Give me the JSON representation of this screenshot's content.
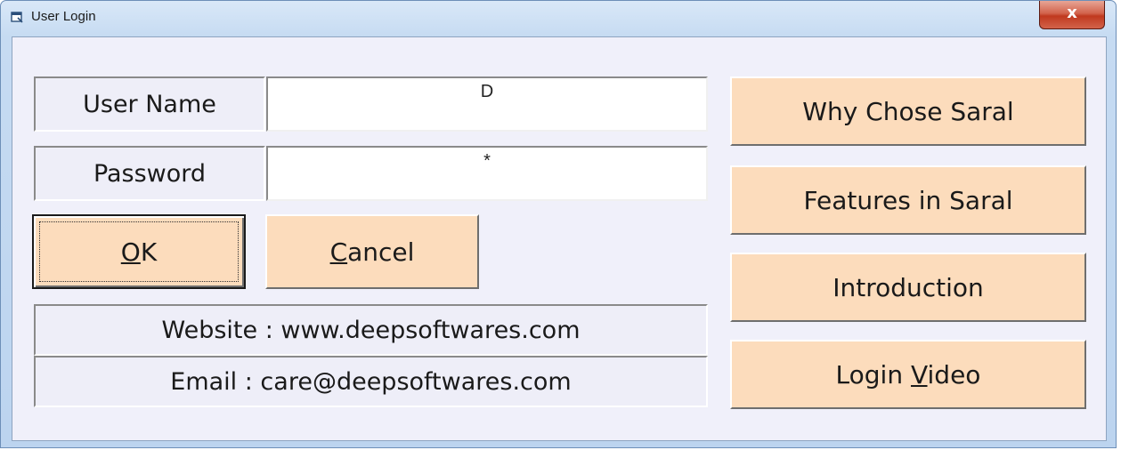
{
  "window": {
    "title": "User Login",
    "close_symbol": "x",
    "icon": "app-window-icon"
  },
  "form": {
    "username_label": "User Name",
    "username_value": "D",
    "password_label": "Password",
    "password_value": "*"
  },
  "buttons": {
    "ok": {
      "mnemonic": "O",
      "rest": "K"
    },
    "cancel": {
      "mnemonic": "C",
      "rest": "ancel"
    },
    "why": "Why Chose Saral",
    "features": "Features in Saral",
    "intro": "Introduction",
    "video": {
      "before": "Login ",
      "mnemonic": "V",
      "rest": "ideo"
    }
  },
  "info": {
    "website": "Website : www.deepsoftwares.com",
    "email": "Email : care@deepsoftwares.com"
  },
  "colors": {
    "button_bg": "#fcdcbc",
    "client_bg": "#f0f0fa",
    "close_red": "#c0391f"
  }
}
